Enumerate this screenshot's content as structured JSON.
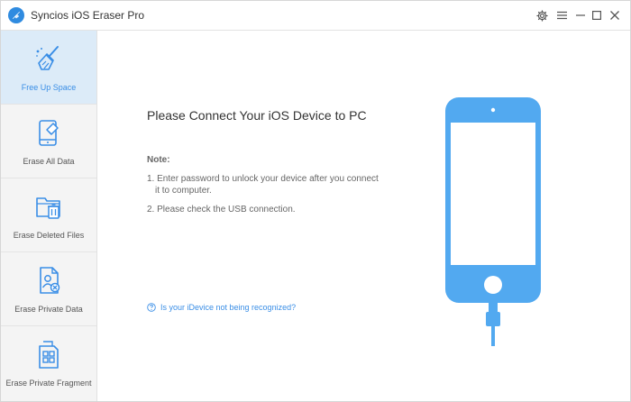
{
  "window": {
    "title": "Syncios iOS Eraser Pro"
  },
  "sidebar": {
    "items": [
      {
        "label": "Free Up Space",
        "icon": "broom-icon",
        "active": true
      },
      {
        "label": "Erase All Data",
        "icon": "phone-erase-icon",
        "active": false
      },
      {
        "label": "Erase Deleted Files",
        "icon": "folder-trash-icon",
        "active": false
      },
      {
        "label": "Erase Private Data",
        "icon": "private-document-icon",
        "active": false
      },
      {
        "label": "Erase Private Fragment",
        "icon": "fragment-grid-icon",
        "active": false
      }
    ]
  },
  "main": {
    "headline": "Please Connect Your iOS Device to PC",
    "note_title": "Note:",
    "notes": [
      {
        "line1": "1. Enter password to unlock your device after you connect",
        "line2": "it to computer."
      },
      {
        "line1": "2. Please check the USB connection.",
        "line2": ""
      }
    ],
    "help_link": "Is your iDevice not being recognized?"
  },
  "colors": {
    "accent": "#3a8ee6",
    "phone": "#52a9f0",
    "sidebar_active": "#dcebf8"
  }
}
